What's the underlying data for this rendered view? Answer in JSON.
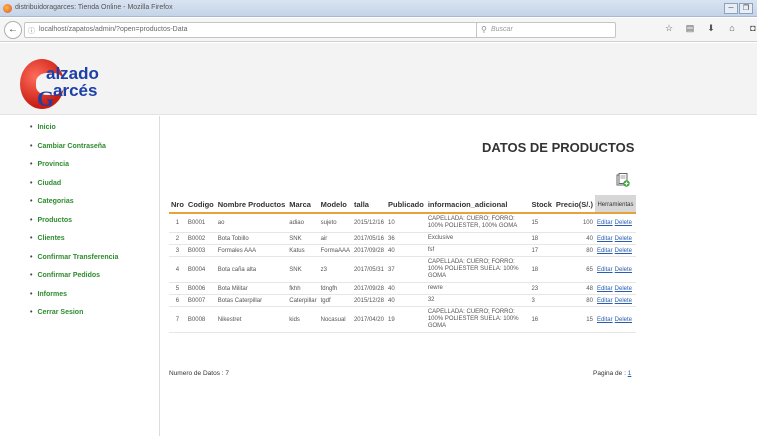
{
  "window": {
    "title": "distribuidoragarces: Tienda Online - Mozilla Firefox"
  },
  "browser": {
    "url": "localhost/zapatos/admin/?open=productos-Data",
    "search_placeholder": "Buscar"
  },
  "logo": {
    "line1": "alzado",
    "line2": "arcés",
    "initial": "G"
  },
  "sidebar": {
    "items": [
      "Inicio",
      "Cambiar Contraseña",
      "Provincia",
      "Ciudad",
      "Categorias",
      "Productos",
      "Clientes",
      "Confirmar Transferencia",
      "Confirmar Pedidos",
      "Informes",
      "Cerrar Sesion"
    ]
  },
  "main": {
    "title": "DATOS DE PRODUCTOS",
    "columns": [
      "Nro",
      "Codigo",
      "Nombre Productos",
      "Marca",
      "Modelo",
      "talla",
      "Publicado",
      "informacion_adicional",
      "Stock",
      "Precio(S/.)",
      "Herramientas"
    ],
    "rows": [
      {
        "nro": "1",
        "codigo": "B0001",
        "nombre": "ao",
        "marca": "adiao",
        "modelo": "sujeto",
        "talla": "",
        "publicado": "2015/12/16",
        "pub_num": "10",
        "info": "CAPELLADA: CUERO; FORRO: 100% POLIESTER, 100% GOMA",
        "stock": "15",
        "precio": "100"
      },
      {
        "nro": "2",
        "codigo": "B0002",
        "nombre": "Bota Tobillo",
        "marca": "SNK",
        "modelo": "air",
        "talla": "",
        "publicado": "2017/05/16",
        "pub_num": "36",
        "info": "Exclusive",
        "stock": "18",
        "precio": "40"
      },
      {
        "nro": "3",
        "codigo": "B0003",
        "nombre": "Formales AAA",
        "marca": "Katus",
        "modelo": "FormaAAA",
        "talla": "",
        "publicado": "2017/09/28",
        "pub_num": "40",
        "info": "fsf",
        "stock": "17",
        "precio": "80"
      },
      {
        "nro": "4",
        "codigo": "B0004",
        "nombre": "Bota caña alta",
        "marca": "SNK",
        "modelo": "z3",
        "talla": "",
        "publicado": "2017/05/31",
        "pub_num": "37",
        "info": "CAPELLADA: CUERO; FORRO: 100% POLIESTER SUELA: 100% GOMA",
        "stock": "18",
        "precio": "65"
      },
      {
        "nro": "5",
        "codigo": "B0006",
        "nombre": "Bota Militar",
        "marca": "fkhh",
        "modelo": "fdngfh",
        "talla": "",
        "publicado": "2017/09/28",
        "pub_num": "40",
        "info": "rewre",
        "stock": "23",
        "precio": "48"
      },
      {
        "nro": "6",
        "codigo": "B0007",
        "nombre": "Botas Caterpillar",
        "marca": "Caterpillar",
        "modelo": "tgdf",
        "talla": "",
        "publicado": "2015/12/28",
        "pub_num": "40",
        "info": "32",
        "stock": "3",
        "precio": "80"
      },
      {
        "nro": "7",
        "codigo": "B0008",
        "nombre": "Nikestret",
        "marca": "kids",
        "modelo": "Nocasual",
        "talla": "",
        "publicado": "2017/04/20",
        "pub_num": "19",
        "info": "CAPELLADA: CUERO; FORRO: 100% POLIESTER SUELA: 100% GOMA",
        "stock": "16",
        "precio": "15"
      }
    ],
    "edit_label": "Editar",
    "delete_label": "Delete",
    "footer_count": "Numero de Datos : 7",
    "page_label": "Pagina de :",
    "page_number": "1"
  }
}
